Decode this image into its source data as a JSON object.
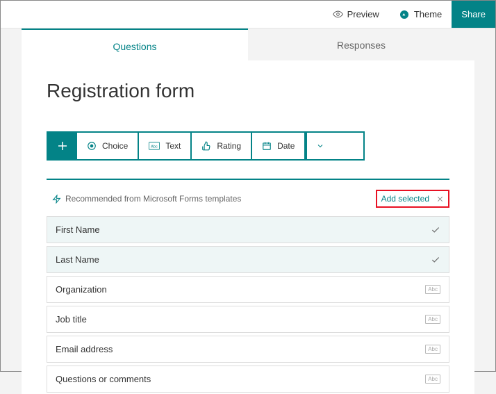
{
  "topbar": {
    "preview": "Preview",
    "theme": "Theme",
    "share": "Share"
  },
  "tabs": {
    "questions": "Questions",
    "responses": "Responses"
  },
  "form": {
    "title": "Registration form"
  },
  "question_types": {
    "choice": "Choice",
    "text": "Text",
    "rating": "Rating",
    "date": "Date"
  },
  "recommend": {
    "header": "Recommended from Microsoft Forms templates",
    "add_selected": "Add selected",
    "items": {
      "first_name": "First Name",
      "last_name": "Last Name",
      "organization": "Organization",
      "job_title": "Job title",
      "email": "Email address",
      "comments": "Questions or comments"
    },
    "abc_tag": "Abc"
  }
}
